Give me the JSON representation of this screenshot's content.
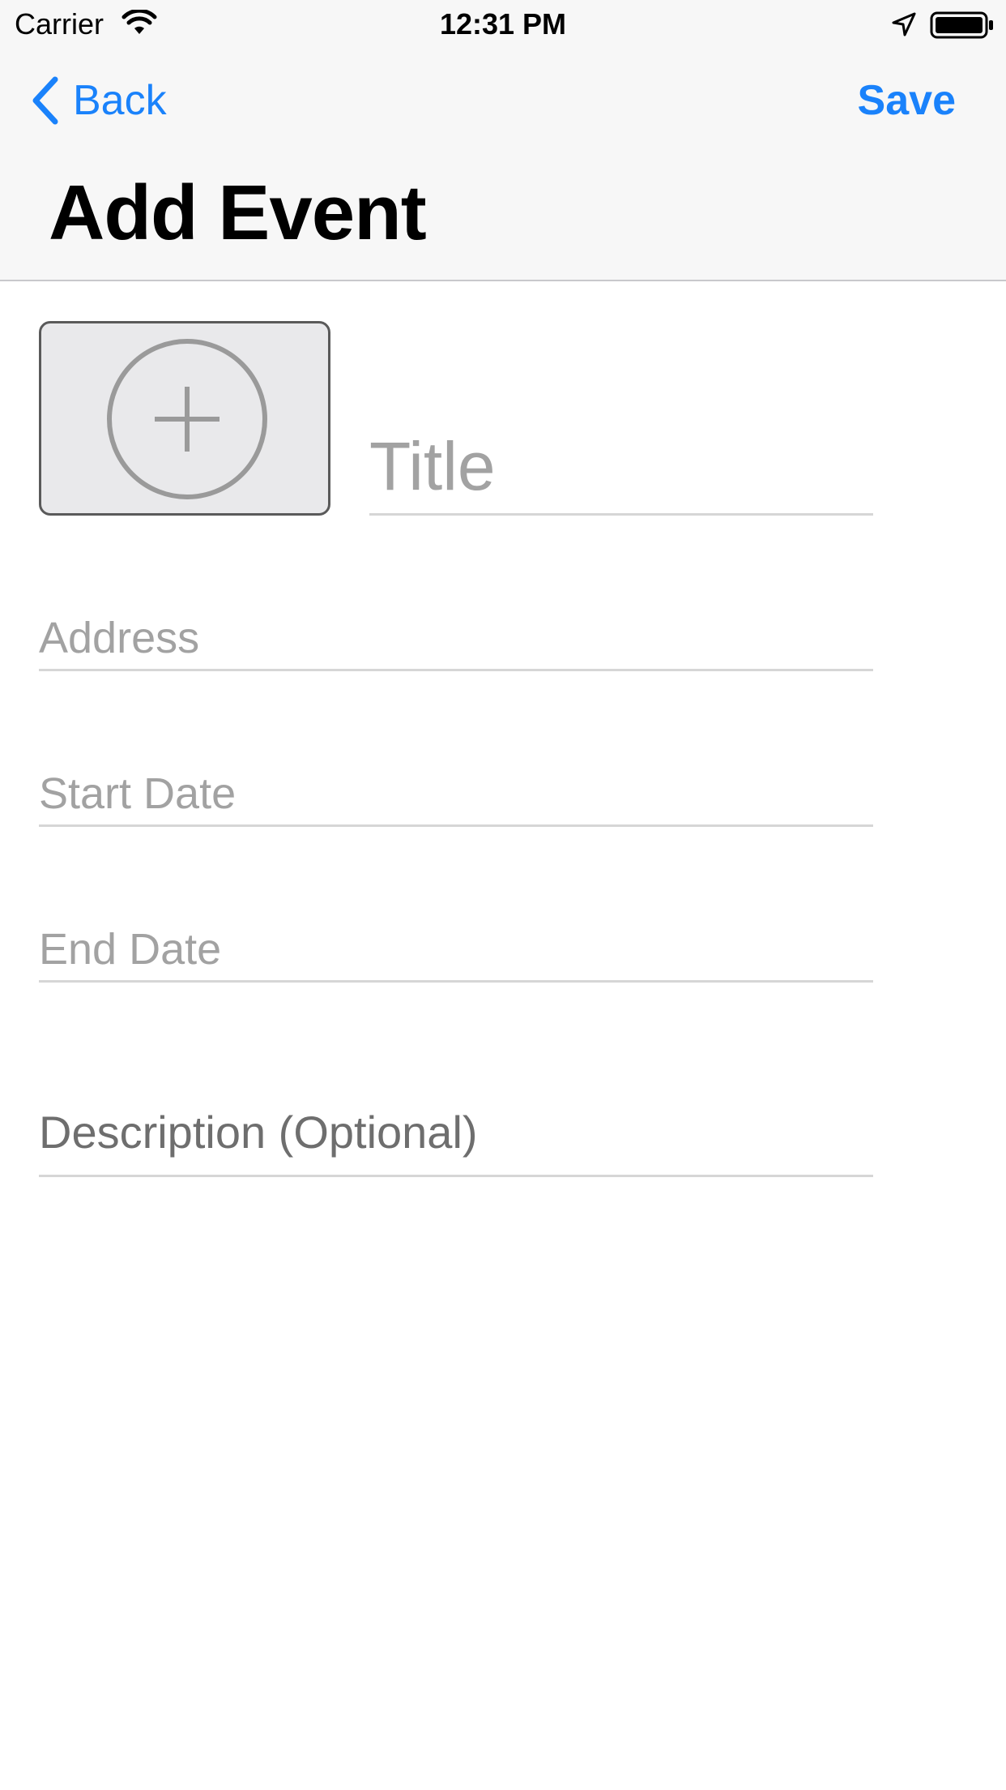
{
  "status_bar": {
    "carrier": "Carrier",
    "time": "12:31 PM",
    "icons": [
      "wifi-icon",
      "location-icon",
      "battery-icon"
    ]
  },
  "nav": {
    "back_label": "Back",
    "save_label": "Save",
    "title": "Add Event"
  },
  "form": {
    "photo_picker_icon": "add-photo-icon",
    "title_placeholder": "Title",
    "address_placeholder": "Address",
    "start_date_placeholder": "Start Date",
    "end_date_placeholder": "End Date",
    "description_placeholder": "Description (Optional)"
  },
  "colors": {
    "accent": "#1a82fb",
    "placeholder": "#a2a2a2",
    "header_bg": "#f7f7f7"
  }
}
